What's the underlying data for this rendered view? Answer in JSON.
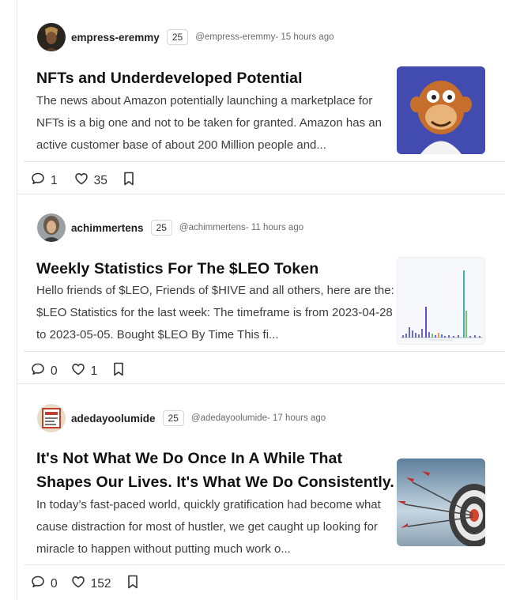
{
  "posts": [
    {
      "author": "empress-eremmy",
      "reputation": "25",
      "handle": "@empress-eremmy",
      "time": " - 15 hours ago",
      "title": "NFTs and Underdeveloped Potential",
      "excerpt": "The news about Amazon potentially launching a marketplace for NFTs is a big one and not to be taken for granted. Amazon has an active customer base of about 200 Million people and...",
      "comments": "1",
      "votes": "35"
    },
    {
      "author": "achimmertens",
      "reputation": "25",
      "handle": "@achimmertens",
      "time": " - 11 hours ago",
      "title": "Weekly Statistics For The $LEO Token",
      "excerpt": "Hello friends of $LEO, Friends of $HIVE and all others, here are the: $LEO Statistics for the last week: The timeframe is from 2023-04-28 to 2023-05-05. Bought $LEO By Time This fi...",
      "comments": "0",
      "votes": "1"
    },
    {
      "author": "adedayoolumide",
      "reputation": "25",
      "handle": "@adedayoolumide",
      "time": " - 17 hours ago",
      "title": "It's Not What We Do Once In A While That Shapes Our Lives. It's What We Do Consistently.",
      "excerpt": "In today’s fast-paced world, quickly gratification had become what cause distraction for most of hustler, we get caught up looking for miracle to happen without putting much work o...",
      "comments": "0",
      "votes": "152"
    }
  ],
  "icons": {
    "comment": "comment-icon",
    "heart": "heart-icon",
    "bookmark": "bookmark-icon"
  }
}
